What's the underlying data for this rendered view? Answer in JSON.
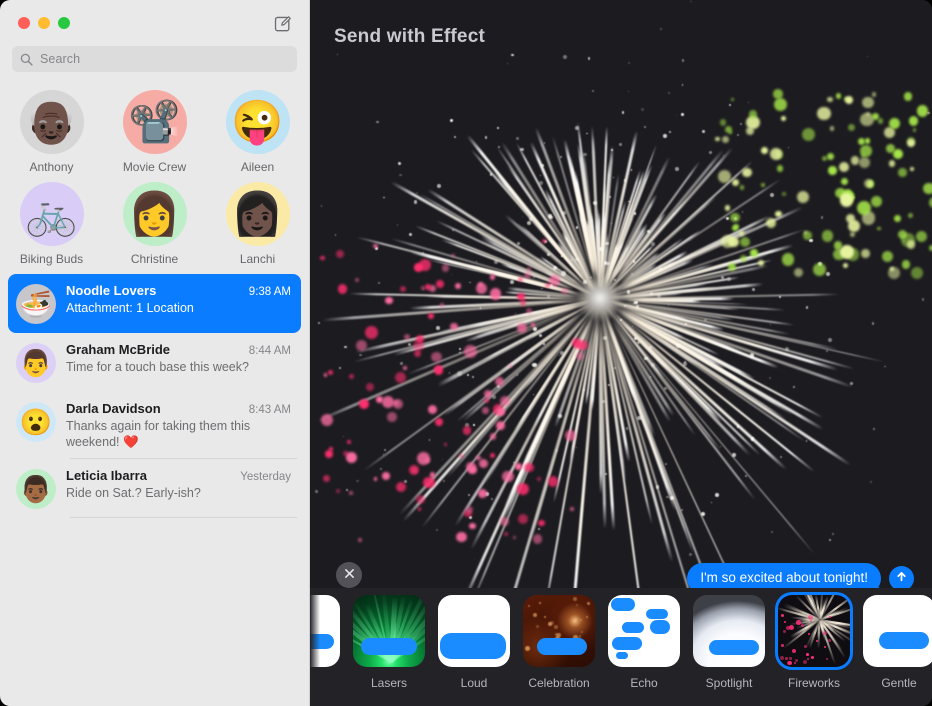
{
  "window": {
    "traffic_lights": [
      "close",
      "minimize",
      "maximize"
    ],
    "compose_icon": "compose-pencil-square-icon",
    "accent_color": "#0a7cff",
    "sidebar_bg": "#e9e9e9",
    "main_bg": "#1c1b20",
    "carousel_bg": "#232227"
  },
  "search": {
    "placeholder": "Search",
    "value": "",
    "icon": "search-icon"
  },
  "pinned": {
    "items": [
      {
        "label": "Anthony",
        "glyph": "👴🏿",
        "bg": "#d6d6d6"
      },
      {
        "label": "Movie Crew",
        "glyph": "📽️",
        "bg": "#f6aba4"
      },
      {
        "label": "Aileen",
        "glyph": "😜",
        "bg": "#bee3f5"
      },
      {
        "label": "Biking Buds",
        "glyph": "🚲",
        "bg": "#d9ccf7"
      },
      {
        "label": "Christine",
        "glyph": "👩",
        "bg": "#bdeec8"
      },
      {
        "label": "Lanchi",
        "glyph": "👩🏿",
        "bg": "#fbe9a6"
      }
    ]
  },
  "conversations": {
    "items": [
      {
        "name": "Noodle Lovers",
        "time": "9:38 AM",
        "preview": "Attachment: 1 Location",
        "glyph": "🍜",
        "avatar_bg": "#c6c6cb",
        "selected": true
      },
      {
        "name": "Graham McBride",
        "time": "8:44 AM",
        "preview": "Time for a touch base this week?",
        "glyph": "👨",
        "avatar_bg": "#ddd0f7",
        "selected": false
      },
      {
        "name": "Darla Davidson",
        "time": "8:43 AM",
        "preview": "Thanks again for taking them this weekend! ❤️",
        "glyph": "😮",
        "avatar_bg": "#cfe8f7",
        "selected": false
      },
      {
        "name": "Leticia Ibarra",
        "time": "Yesterday",
        "preview": "Ride on Sat.? Early-ish?",
        "glyph": "👨🏾",
        "avatar_bg": "#bdeec8",
        "selected": false
      }
    ]
  },
  "effect_panel": {
    "title": "Send with Effect",
    "close_icon": "close-x-icon",
    "preview_effect": "Fireworks",
    "message": {
      "text": "I'm so excited about tonight!",
      "bubble_color": "#0a7cff"
    },
    "send_button": {
      "icon": "arrow-up-icon",
      "label": "Send"
    },
    "effects": [
      {
        "label": "",
        "style": "gentle-partial",
        "selected": false,
        "partial": true
      },
      {
        "label": "Lasers",
        "style": "lasers",
        "selected": false,
        "partial": false
      },
      {
        "label": "Loud",
        "style": "loud",
        "selected": false,
        "partial": false
      },
      {
        "label": "Celebration",
        "style": "celebration",
        "selected": false,
        "partial": false
      },
      {
        "label": "Echo",
        "style": "echo",
        "selected": false,
        "partial": false
      },
      {
        "label": "Spotlight",
        "style": "spotlight",
        "selected": false,
        "partial": false
      },
      {
        "label": "Fireworks",
        "style": "fireworks",
        "selected": true,
        "partial": false
      },
      {
        "label": "Gentle",
        "style": "gentle",
        "selected": false,
        "partial": false
      }
    ]
  }
}
